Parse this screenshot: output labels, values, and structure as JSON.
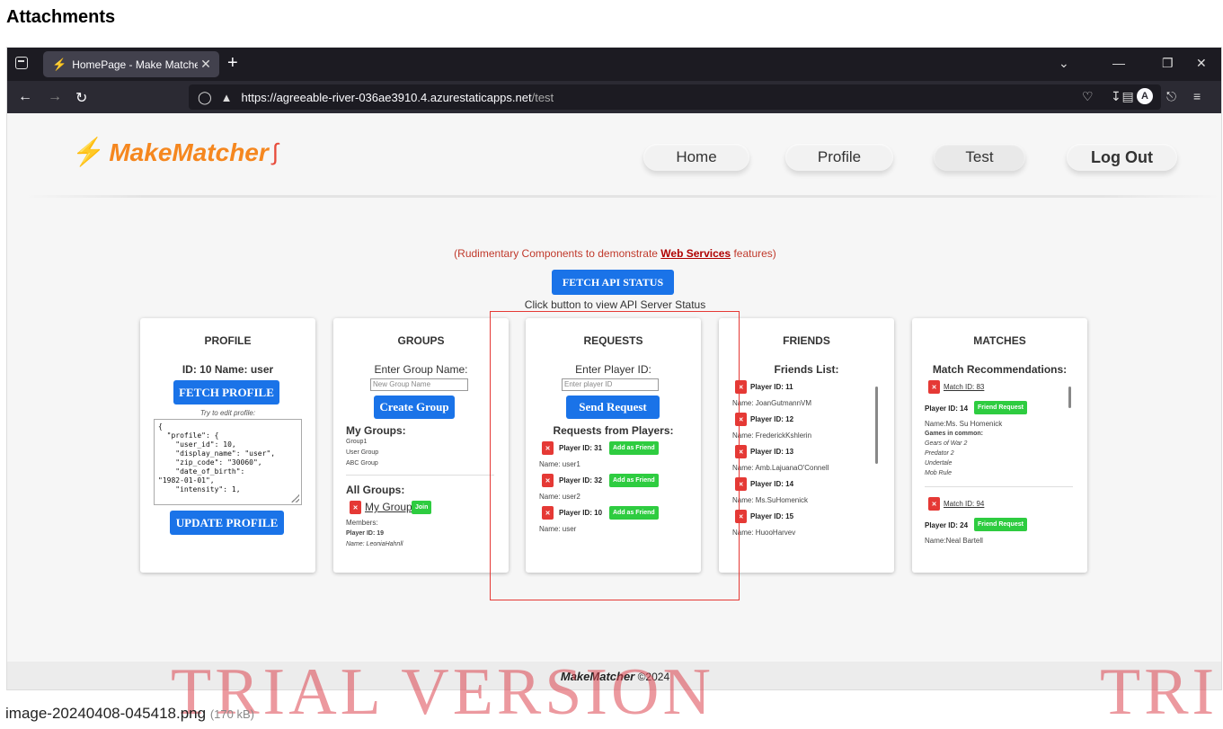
{
  "attachments": {
    "title": "Attachments",
    "filename": "image-20240408-045418.png",
    "size": "(170 kB)"
  },
  "watermark": {
    "left": "TRIAL VERSION",
    "right": "TRI"
  },
  "browser": {
    "tab_title": "HomePage - Make Matcher Tea",
    "url_host": "https://agreeable-river-036ae3910.4.azurestaticapps.net",
    "url_path": "/test",
    "avatar_letter": "A"
  },
  "site": {
    "logo_text": "MakeMatcher",
    "nav": [
      "Home",
      "Profile",
      "Test",
      "Log Out"
    ],
    "note_prefix": "(Rudimentary Components to demonstrate ",
    "note_link": "Web Services",
    "note_suffix": " features)",
    "fetch_status_label": "FETCH API STATUS",
    "fetch_hint": "Click button to view API Server Status",
    "footer_brand": "MakeMatcher",
    "footer_copy": "©2024"
  },
  "profile": {
    "title": "PROFILE",
    "id_name": "ID: 10 Name: user",
    "fetch_label": "FETCH PROFILE",
    "hint": "Try to edit profile:",
    "json": "{\n  \"profile\": {\n    \"user_id\": 10,\n    \"display_name\": \"user\",\n    \"zip_code\": \"30060\",\n    \"date_of_birth\":\n\"1982-01-01\",\n    \"intensity\": 1,",
    "update_label": "UPDATE PROFILE"
  },
  "groups": {
    "title": "GROUPS",
    "enter_label": "Enter Group Name:",
    "input_placeholder": "New Group Name",
    "create_label": "Create Group",
    "my_groups_label": "My Groups:",
    "my_groups": [
      "Group1",
      "User Group",
      "ABC Group"
    ],
    "all_groups_label": "All Groups:",
    "group_name": "My Group",
    "join_label": "Join",
    "members_label": "Members:",
    "member_id": "Player ID: 19",
    "member_name": "Name: LeoniaHahnll"
  },
  "requests": {
    "title": "REQUESTS",
    "enter_label": "Enter Player ID:",
    "input_placeholder": "Enter player ID",
    "send_label": "Send Request",
    "from_label": "Requests from Players:",
    "add_label": "Add as Friend",
    "items": [
      {
        "id": "Player ID: 31",
        "name": "Name: user1"
      },
      {
        "id": "Player ID: 32",
        "name": "Name: user2"
      },
      {
        "id": "Player ID: 10",
        "name": "Name: user"
      }
    ]
  },
  "friends": {
    "title": "FRIENDS",
    "list_label": "Friends List:",
    "items": [
      {
        "id": "Player ID: 11",
        "name": "Name: JoanGutmannVM"
      },
      {
        "id": "Player ID: 12",
        "name": "Name: FrederickKshlerin"
      },
      {
        "id": "Player ID: 13",
        "name": "Name: Amb.LajuanaO'Connell"
      },
      {
        "id": "Player ID: 14",
        "name": "Name: Ms.SuHomenick"
      },
      {
        "id": "Player ID: 15",
        "name": "Name: HuooHarvev"
      }
    ]
  },
  "matches": {
    "title": "MATCHES",
    "rec_label": "Match Recommendations:",
    "friend_req_label": "Friend Request",
    "games_label": "Games in common:",
    "m1": {
      "match": "Match ID: 83",
      "player": "Player ID: 14",
      "name": "Name:Ms. Su Homenick",
      "games": [
        "Gears of War 2",
        "Predator 2",
        "Undertale",
        "Mob Rule"
      ]
    },
    "m2": {
      "match": "Match ID: 94",
      "player": "Player ID: 24",
      "name": "Name:Neal Bartell"
    }
  },
  "colors": {
    "primary_button": "#1a73e8",
    "remove_button": "#e53935",
    "add_button": "#2ecc40",
    "logo": "#f5871f"
  }
}
